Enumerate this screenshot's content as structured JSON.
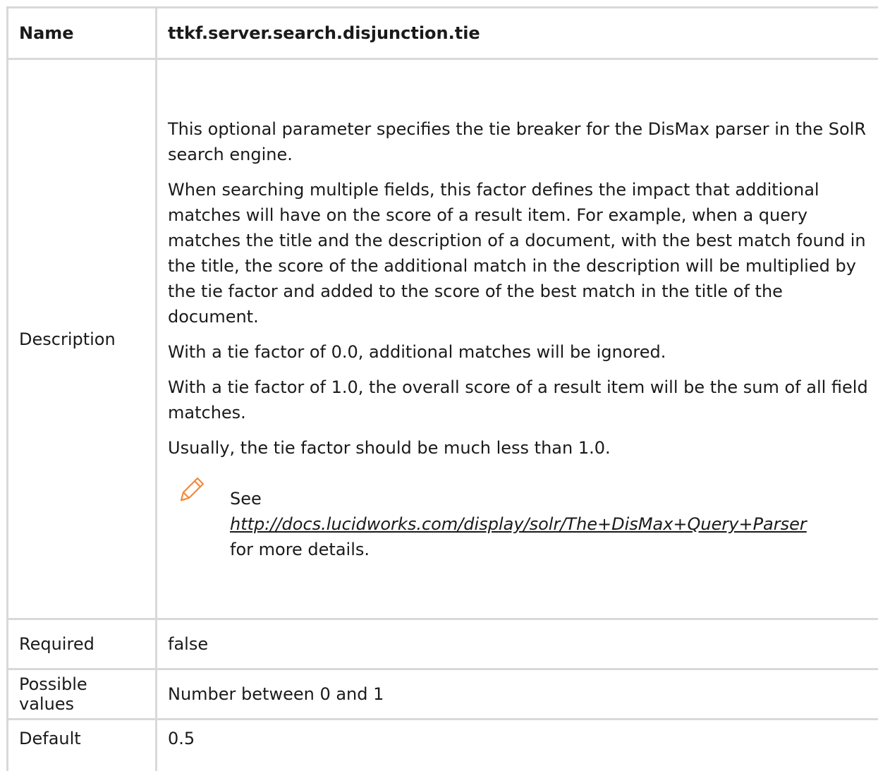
{
  "header": {
    "label": "Name",
    "value": "ttkf.server.search.disjunction.tie"
  },
  "description": {
    "label": "Description",
    "paragraphs": [
      "This optional parameter specifies the tie breaker for the DisMax parser in the SolR search engine.",
      "When searching multiple fields, this factor defines the impact that additional matches will have on the score of a result item. For example, when a query matches the title and the description of a document, with the best match found in the title, the score of the additional match in the description will be multiplied by the tie factor and added to the score of the best match in the title of the document.",
      "With a tie factor of 0.0, additional matches will be ignored.",
      "With a tie factor of 1.0, the overall score of a result item will be the sum of all field matches.",
      "Usually, the tie factor should be much less than 1.0."
    ],
    "note": {
      "icon": "pencil-icon",
      "icon_color": "#f08a3a",
      "prefix": "See",
      "link": "http://docs.lucidworks.com/display/solr/The+DisMax+Query+Parser",
      "suffix": "for more details."
    }
  },
  "rows": {
    "required": {
      "label": "Required",
      "value": "false"
    },
    "possible_values": {
      "label": "Possible values",
      "value": "Number between 0 and 1"
    },
    "default": {
      "label": "Default",
      "value": "0.5"
    }
  }
}
